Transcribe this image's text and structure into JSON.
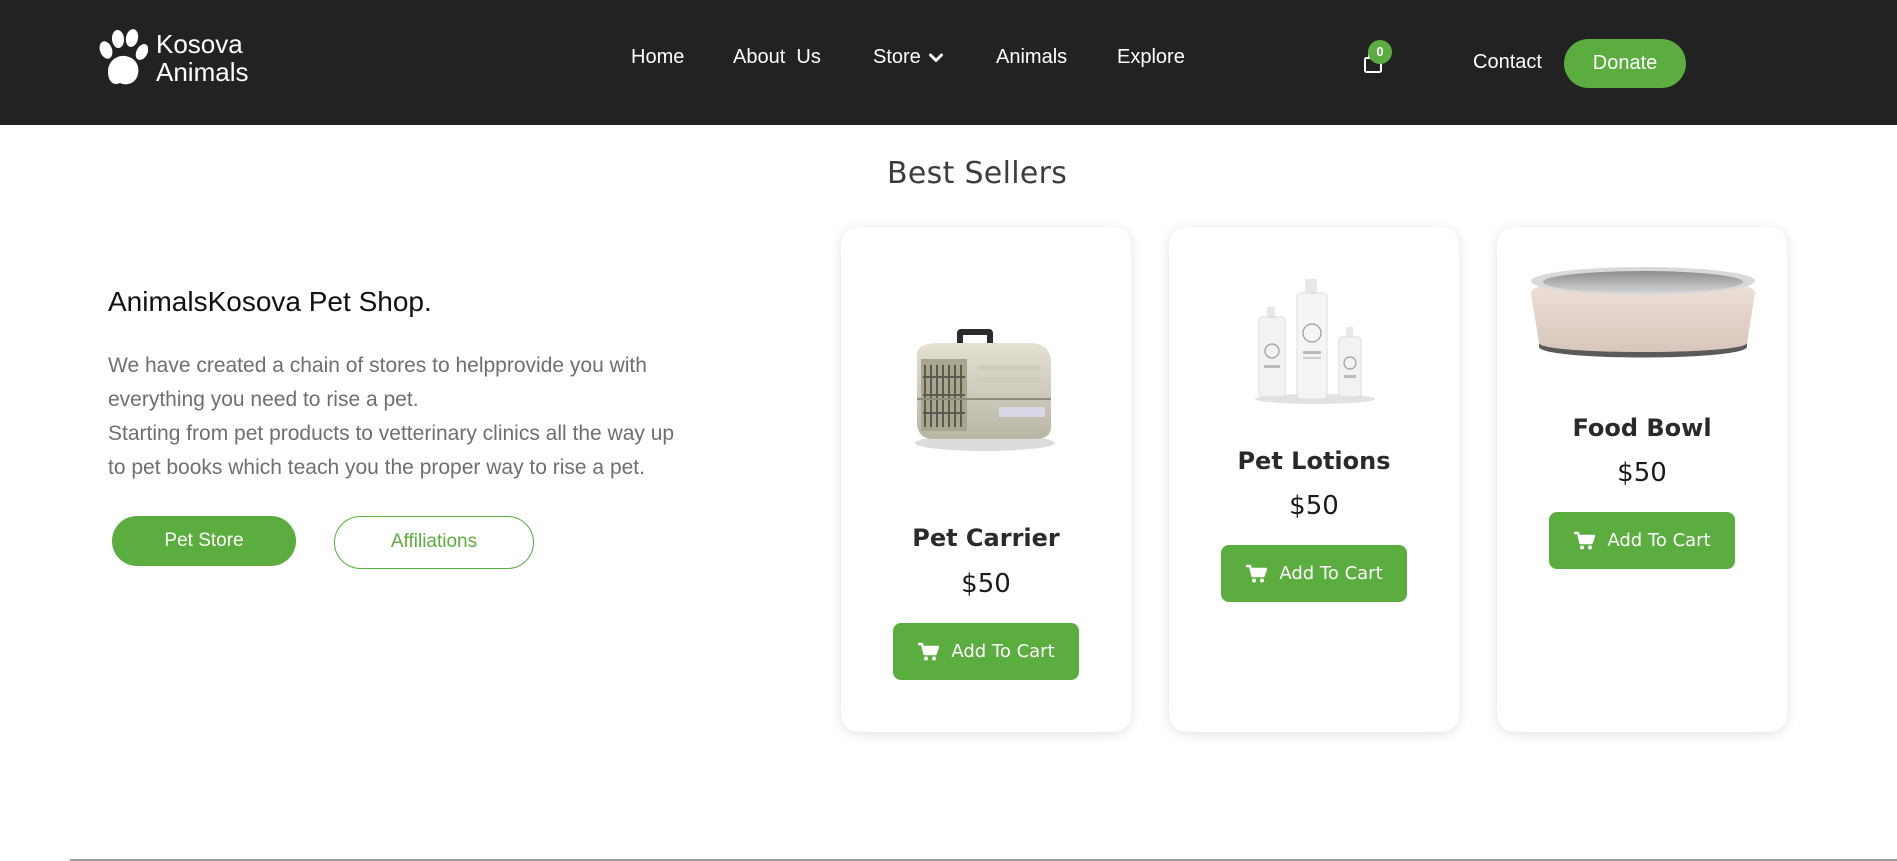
{
  "header": {
    "logo_line1": "Kosova",
    "logo_line2": "Animals",
    "logo_icon": "paw-icon",
    "nav": [
      {
        "label": "Home"
      },
      {
        "label": "About  Us"
      },
      {
        "label": "Store",
        "has_dropdown": true
      },
      {
        "label": "Animals"
      },
      {
        "label": "Explore"
      }
    ],
    "cart_icon": "shopping-bag-icon",
    "cart_count": "0",
    "contact_label": "Contact",
    "donate_label": "Donate"
  },
  "best_sellers": {
    "title": "Best Sellers",
    "products": [
      {
        "name": "Pet Carrier",
        "price": "$50",
        "button_label": "Add To Cart",
        "image_icon": "pet-carrier-image"
      },
      {
        "name": "Pet Lotions",
        "price": "$50",
        "button_label": "Add To Cart",
        "image_icon": "lotion-bottles-image"
      },
      {
        "name": "Food Bowl",
        "price": "$50",
        "button_label": "Add To Cart",
        "image_icon": "food-bowl-image"
      }
    ]
  },
  "intro": {
    "title": "AnimalsKosova Pet Shop.",
    "text_line1": "We have created a chain of stores to helpprovide you with",
    "text_line2": "everything you need to rise a pet.",
    "text_line3": "Starting from pet products to vetterinary clinics all the way up",
    "text_line4": "to pet books which teach you the proper way to rise a pet.",
    "primary_button": "Pet Store",
    "secondary_button": "Affiliations"
  },
  "colors": {
    "accent": "#5aad3e",
    "header_bg": "#222222",
    "text_muted": "#6f6f6f"
  }
}
